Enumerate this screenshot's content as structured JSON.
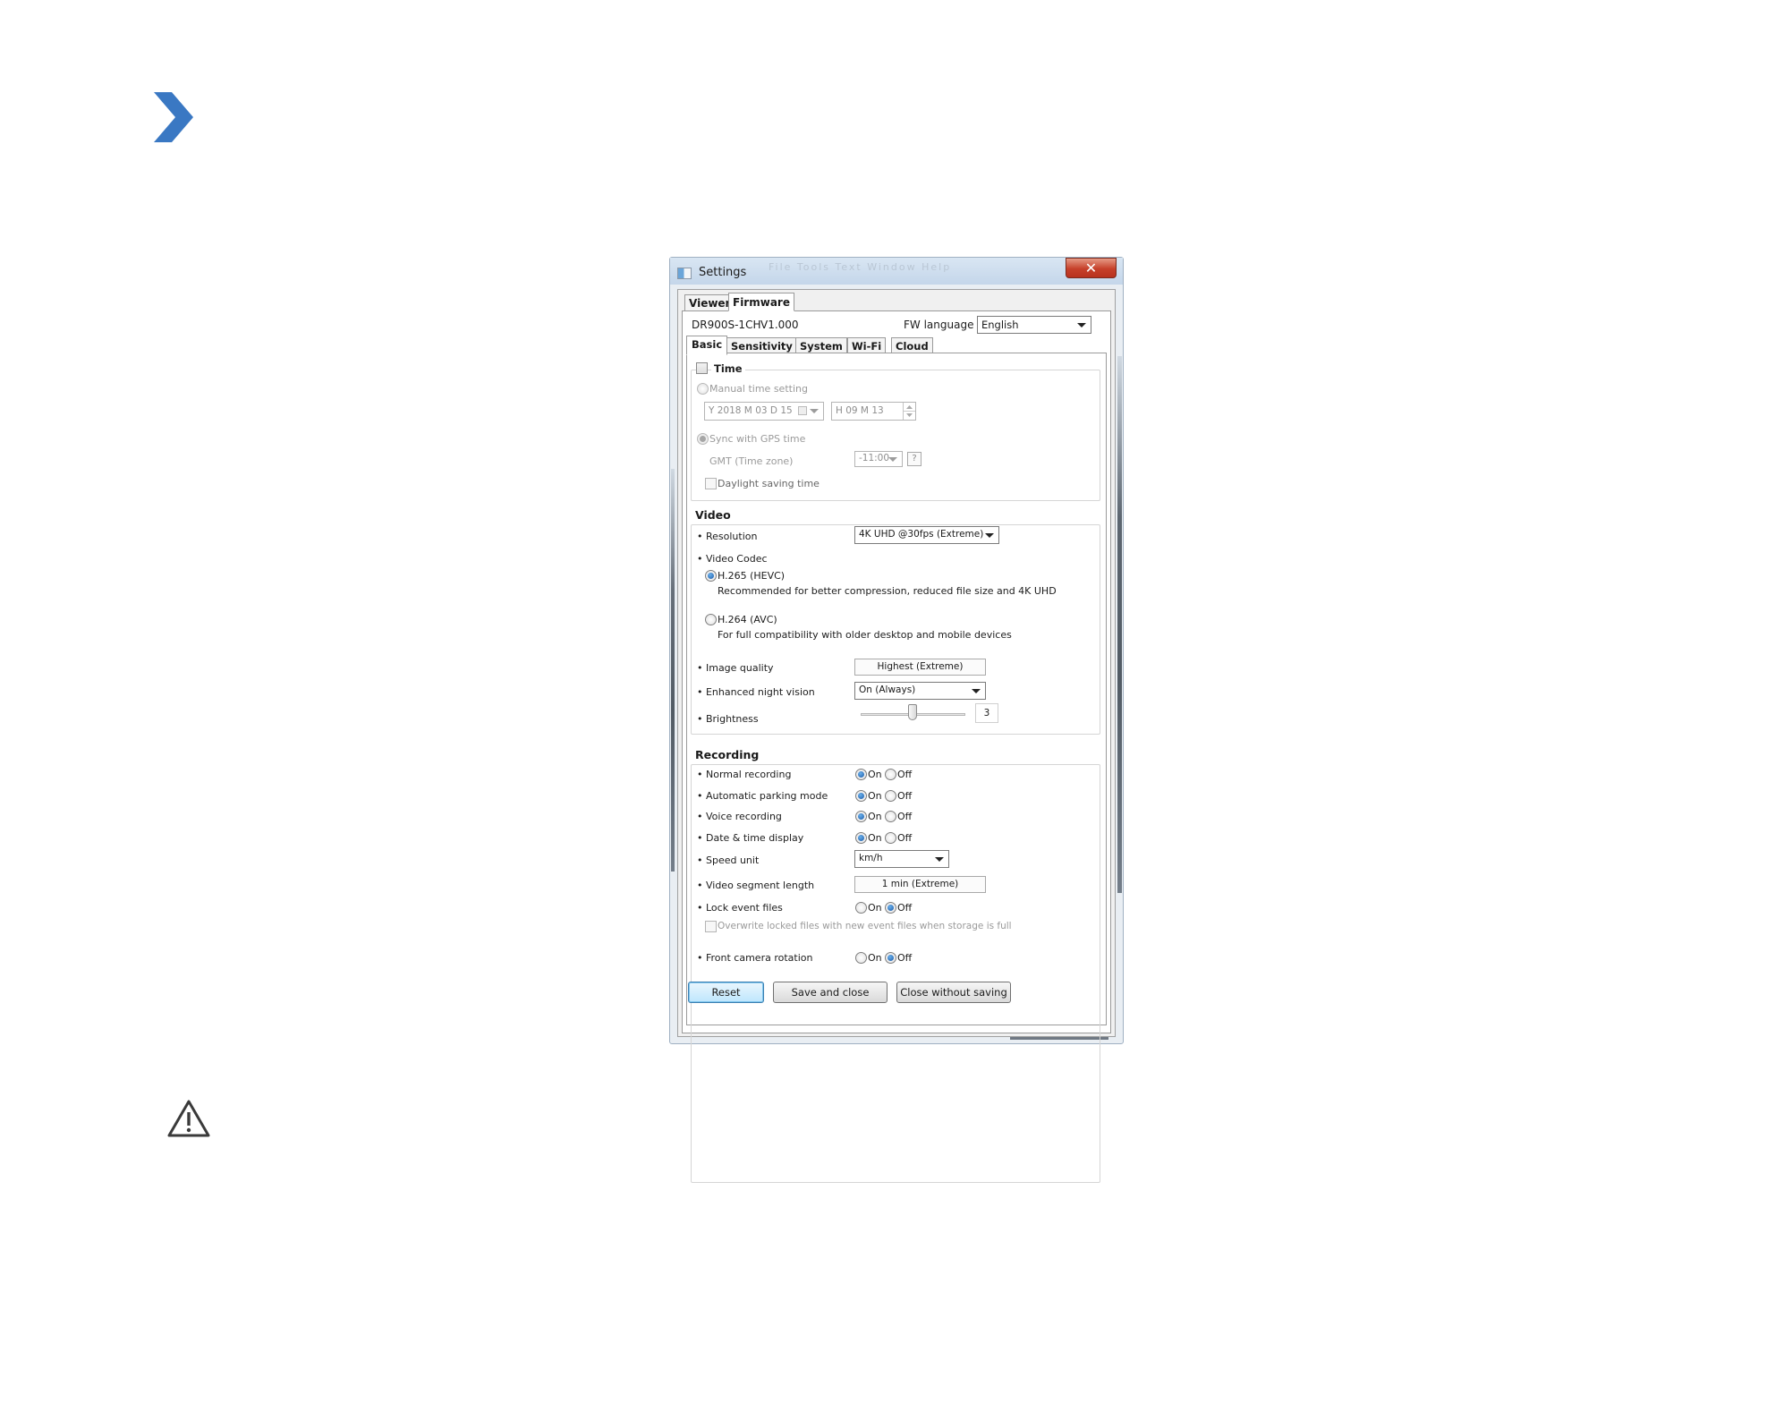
{
  "page": {
    "chevron_color": "#3a78c3",
    "icons": [
      "chevron-right-icon",
      "warning-icon"
    ]
  },
  "window": {
    "title": "Settings",
    "ghost_menu": "File  Tools  Text  Window  Help",
    "close_glyph": "✕",
    "main_tabs": [
      "Viewer",
      "Firmware"
    ],
    "active_main_tab": "Firmware",
    "model": "DR900S-1CH",
    "version": "V1.000",
    "fw_language_label": "FW language",
    "fw_language_value": "English",
    "sub_tabs": [
      "Basic",
      "Sensitivity",
      "System",
      "Wi-Fi",
      "Cloud"
    ],
    "active_sub_tab": "Basic"
  },
  "time": {
    "title": "Time",
    "enabled": false,
    "manual_label": "Manual time setting",
    "date_value": "Y 2018 M 03 D 15",
    "time_value": "H 09 M 13",
    "gps_label": "Sync with GPS time",
    "gmt_label": "GMT (Time zone)",
    "gmt_value": "-11:00",
    "help_glyph": "?",
    "dst_label": "Daylight saving time"
  },
  "video": {
    "title": "Video",
    "resolution_label": "• Resolution",
    "resolution_value": "4K UHD @30fps (Extreme)",
    "codec_label": "• Video Codec",
    "h265_label": "H.265 (HEVC)",
    "h265_desc": "Recommended for better compression, reduced file size and 4K UHD",
    "h264_label": "H.264 (AVC)",
    "h264_desc": "For full compatibility with older desktop and mobile devices",
    "selected_codec": "H.265 (HEVC)",
    "image_quality_label": "• Image quality",
    "image_quality_value": "Highest (Extreme)",
    "night_vision_label": "• Enhanced night vision",
    "night_vision_value": "On (Always)",
    "brightness_label": "• Brightness",
    "brightness_value": "3",
    "brightness_level": 0.5
  },
  "recording": {
    "title": "Recording",
    "on_label": "On",
    "off_label": "Off",
    "rows": [
      {
        "label": "• Normal recording",
        "value": "On"
      },
      {
        "label": "• Automatic parking mode",
        "value": "On"
      },
      {
        "label": "• Voice recording",
        "value": "On"
      },
      {
        "label": "• Date & time display",
        "value": "On"
      }
    ],
    "speed_unit_label": "• Speed unit",
    "speed_unit_value": "km/h",
    "segment_label": "• Video segment length",
    "segment_value": "1 min (Extreme)",
    "lock_label": "• Lock event files",
    "lock_value": "Off",
    "overwrite_label": "Overwrite locked files with new event files when storage is full",
    "rotation_label": "• Front camera rotation",
    "rotation_value": "Off"
  },
  "buttons": {
    "reset": "Reset",
    "save_close": "Save and close",
    "close_no_save": "Close without saving"
  }
}
